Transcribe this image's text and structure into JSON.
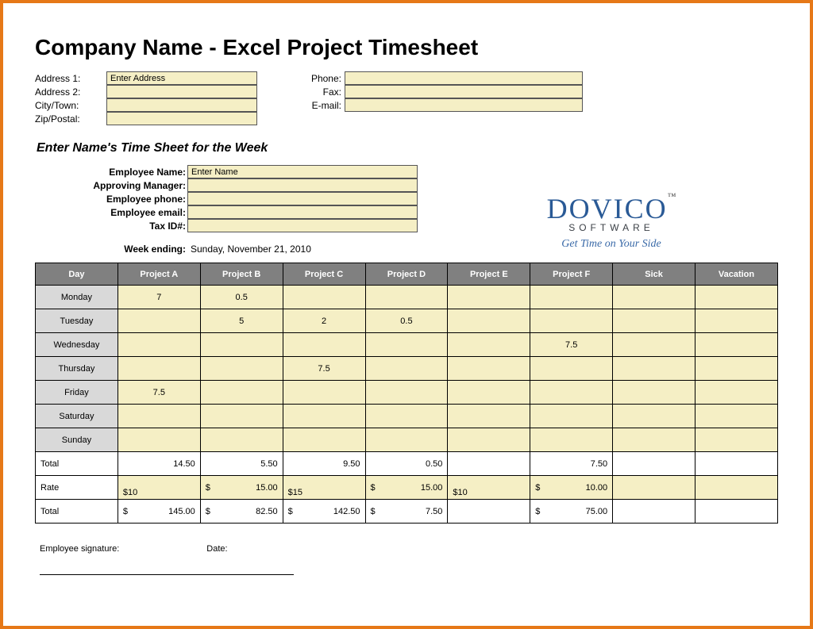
{
  "title": "Company Name - Excel Project Timesheet",
  "company": {
    "address1_label": "Address 1:",
    "address1_value": "Enter Address",
    "address2_label": "Address 2:",
    "address2_value": "",
    "city_label": "City/Town:",
    "city_value": "",
    "zip_label": "Zip/Postal:",
    "zip_value": "",
    "phone_label": "Phone:",
    "phone_value": "",
    "fax_label": "Fax:",
    "fax_value": "",
    "email_label": "E-mail:",
    "email_value": ""
  },
  "subhead": "Enter Name's Time Sheet for the Week",
  "employee": {
    "name_label": "Employee Name:",
    "name_value": "Enter Name",
    "manager_label": "Approving Manager:",
    "manager_value": "",
    "phone_label": "Employee phone:",
    "phone_value": "",
    "email_label": "Employee email:",
    "email_value": "",
    "tax_label": "Tax ID#:",
    "tax_value": ""
  },
  "week_ending_label": "Week ending:",
  "week_ending_value": "Sunday, November 21, 2010",
  "logo": {
    "brand": "DOVICO",
    "tm": "™",
    "subtitle": "SOFTWARE",
    "tagline": "Get Time on Your Side"
  },
  "headers": [
    "Day",
    "Project A",
    "Project B",
    "Project C",
    "Project D",
    "Project E",
    "Project F",
    "Sick",
    "Vacation"
  ],
  "days": [
    {
      "day": "Monday",
      "cells": [
        "7",
        "0.5",
        "",
        "",
        "",
        "",
        "",
        ""
      ]
    },
    {
      "day": "Tuesday",
      "cells": [
        "",
        "5",
        "2",
        "0.5",
        "",
        "",
        "",
        ""
      ]
    },
    {
      "day": "Wednesday",
      "cells": [
        "",
        "",
        "",
        "",
        "",
        "7.5",
        "",
        ""
      ]
    },
    {
      "day": "Thursday",
      "cells": [
        "",
        "",
        "7.5",
        "",
        "",
        "",
        "",
        ""
      ]
    },
    {
      "day": "Friday",
      "cells": [
        "7.5",
        "",
        "",
        "",
        "",
        "",
        "",
        ""
      ]
    },
    {
      "day": "Saturday",
      "cells": [
        "",
        "",
        "",
        "",
        "",
        "",
        "",
        ""
      ]
    },
    {
      "day": "Sunday",
      "cells": [
        "",
        "",
        "",
        "",
        "",
        "",
        "",
        ""
      ]
    }
  ],
  "totals_label": "Total",
  "totals": [
    "14.50",
    "5.50",
    "9.50",
    "0.50",
    "",
    "7.50",
    "",
    ""
  ],
  "rate_label": "Rate",
  "rates": [
    {
      "dollar": "$10",
      "val": ""
    },
    {
      "dollar": "$",
      "val": "15.00"
    },
    {
      "dollar": "$15",
      "val": ""
    },
    {
      "dollar": "$",
      "val": "15.00"
    },
    {
      "dollar": "$10",
      "val": ""
    },
    {
      "dollar": "$",
      "val": "10.00"
    },
    {
      "dollar": "",
      "val": ""
    },
    {
      "dollar": "",
      "val": ""
    }
  ],
  "grand_label": "Total",
  "grands": [
    {
      "dollar": "$",
      "val": "145.00"
    },
    {
      "dollar": "$",
      "val": "82.50"
    },
    {
      "dollar": "$",
      "val": "142.50"
    },
    {
      "dollar": "$",
      "val": "7.50"
    },
    {
      "dollar": "",
      "val": ""
    },
    {
      "dollar": "$",
      "val": "75.00"
    },
    {
      "dollar": "",
      "val": ""
    },
    {
      "dollar": "",
      "val": ""
    }
  ],
  "sig": {
    "emp_label": "Employee signature:",
    "date_label": "Date:"
  }
}
